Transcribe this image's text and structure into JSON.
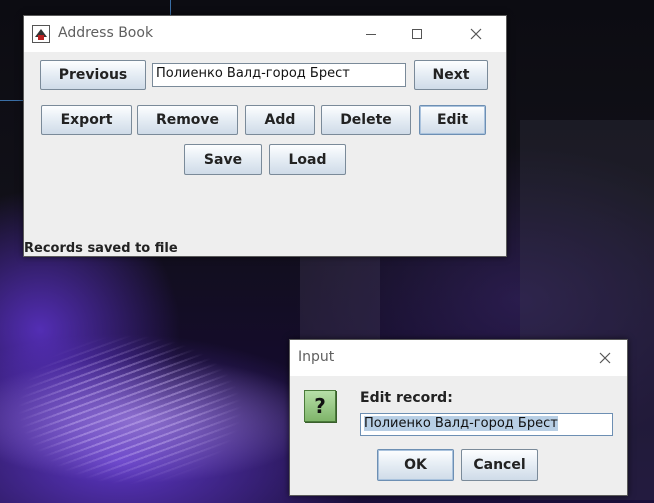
{
  "main_window": {
    "title": "Address Book",
    "record_value": "Полиенко Валд-город Брест",
    "buttons": {
      "previous": "Previous",
      "next": "Next",
      "export": "Export",
      "remove": "Remove",
      "add": "Add",
      "delete": "Delete",
      "edit": "Edit",
      "save": "Save",
      "load": "Load"
    },
    "status": "Records saved to file"
  },
  "input_dialog": {
    "title": "Input",
    "prompt": "Edit record:",
    "value": "Полиенко Валд-город Брест",
    "ok": "OK",
    "cancel": "Cancel"
  },
  "icons": {
    "app": "java-app-icon",
    "question": "question-icon"
  }
}
